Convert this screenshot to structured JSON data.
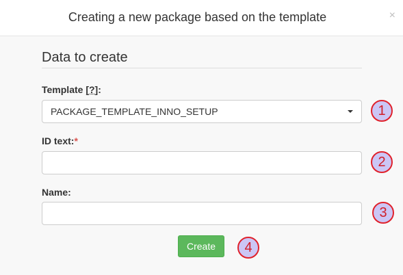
{
  "dialog": {
    "title": "Creating a new package based on the template",
    "close_label": "×"
  },
  "form": {
    "section_title": "Data to create",
    "template": {
      "label": "Template",
      "help_label": "[?]",
      "label_suffix": ":",
      "value": "PACKAGE_TEMPLATE_INNO_SETUP"
    },
    "id_text": {
      "label": "ID text:",
      "required_mark": "*",
      "value": ""
    },
    "name": {
      "label": "Name:",
      "value": ""
    },
    "create_label": "Create"
  },
  "markers": [
    "1",
    "2",
    "3",
    "4"
  ],
  "colors": {
    "accent_button": "#5cb85c",
    "required": "#d9534f",
    "marker_fill": "#ccc6f5",
    "marker_border": "#e0212b"
  }
}
